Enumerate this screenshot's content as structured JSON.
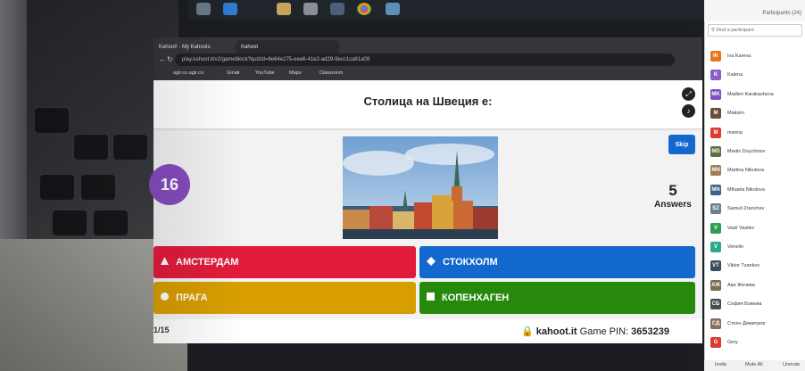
{
  "browser": {
    "tabs": [
      "Kahoot! - My Kahoots",
      "Kahoot"
    ],
    "url": "play.kahoot.it/v2/gameblock?quizId=8e64e275-eee6-41e2-ad29-9ecc1ca61a09",
    "bookmarks": [
      "agir.co.agir.co",
      "Gmail",
      "YouTube",
      "Maps",
      "Classroom"
    ]
  },
  "game": {
    "question": "Столица на Швеция е:",
    "timer": "16",
    "skip_label": "Skip",
    "answers_count": "5",
    "answers_label": "Answers",
    "options": [
      {
        "text": "АМСТЕРДАМ",
        "shape": "triangle",
        "color": "#e21b3c"
      },
      {
        "text": "СТОКХОЛМ",
        "shape": "diamond",
        "color": "#1368ce"
      },
      {
        "text": "ПРАГА",
        "shape": "circle",
        "color": "#d89e00"
      },
      {
        "text": "КОПЕНХАГЕН",
        "shape": "square",
        "color": "#26890c"
      }
    ],
    "footer_left": "1/15",
    "brand": "kahoot.it",
    "pin_label": "Game PIN:",
    "pin": "3653239"
  },
  "participants": {
    "title": "Participants (24)",
    "search_placeholder": "Find a participant",
    "list": [
      {
        "name": "Iva Kareva",
        "initial": "IK",
        "color": "#e8731a"
      },
      {
        "name": "Kalena",
        "initial": "K",
        "color": "#8b5cc7"
      },
      {
        "name": "Madlen Karakasheva",
        "initial": "MK",
        "color": "#7a4fc0"
      },
      {
        "name": "Maksim",
        "initial": "M",
        "color": "#6b4a3a"
      },
      {
        "name": "marina",
        "initial": "M",
        "color": "#d9382f"
      },
      {
        "name": "Martin Doychinov",
        "initial": "MD",
        "color": "#5a6b3c"
      },
      {
        "name": "Martina Nikolova",
        "initial": "MN",
        "color": "#9c7a55"
      },
      {
        "name": "Mihaela Nikolova",
        "initial": "MN",
        "color": "#3a5f8a"
      },
      {
        "name": "Samuil Zranchev",
        "initial": "SZ",
        "color": "#6b7c8d"
      },
      {
        "name": "Vasil Vasilev",
        "initial": "V",
        "color": "#2f9a54"
      },
      {
        "name": "Venelin",
        "initial": "V",
        "color": "#2aa88a"
      },
      {
        "name": "Viktor Tzankov",
        "initial": "VT",
        "color": "#3a4b5c"
      },
      {
        "name": "Ава Жечева",
        "initial": "АЖ",
        "color": "#7a6a50"
      },
      {
        "name": "София Божева",
        "initial": "СБ",
        "color": "#4a4a4a"
      },
      {
        "name": "Стоян Димитров",
        "initial": "СД",
        "color": "#8a6a5a"
      },
      {
        "name": "Gery",
        "initial": "G",
        "color": "#d9382f"
      }
    ],
    "footer": [
      "Invite",
      "Mute All",
      "Unmute"
    ]
  }
}
